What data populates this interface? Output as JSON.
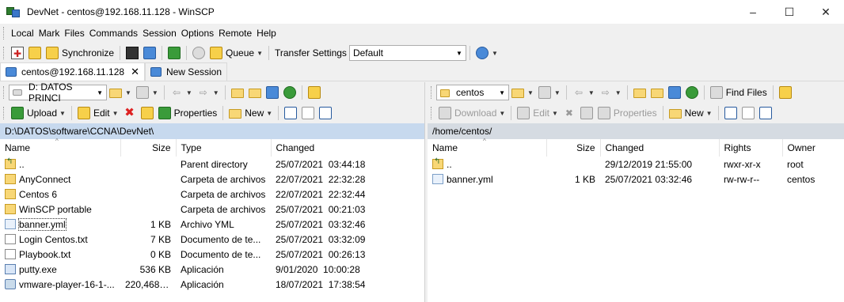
{
  "window": {
    "title": "DevNet - centos@192.168.11.128 - WinSCP",
    "controls": {
      "minimize": "–",
      "maximize": "☐",
      "close": "✕"
    }
  },
  "menu": [
    "Local",
    "Mark",
    "Files",
    "Commands",
    "Session",
    "Options",
    "Remote",
    "Help"
  ],
  "toolbar": {
    "synchronize": "Synchronize",
    "queue": "Queue",
    "transfer_settings_label": "Transfer Settings",
    "transfer_settings_value": "Default"
  },
  "tabs": [
    {
      "label": "centos@192.168.11.128",
      "close": "✕"
    },
    {
      "label": "New Session"
    }
  ],
  "left": {
    "drive": "D: DATOS PRINCI",
    "actions": {
      "upload": "Upload",
      "edit": "Edit",
      "properties": "Properties",
      "new": "New"
    },
    "path": "D:\\DATOS\\software\\CCNA\\DevNet\\",
    "columns": {
      "name": "Name",
      "size": "Size",
      "type": "Type",
      "changed": "Changed"
    },
    "rows": [
      {
        "icon": "parent",
        "name": "..",
        "size": "",
        "type": "Parent directory",
        "changed": "25/07/2021  03:44:18"
      },
      {
        "icon": "folder",
        "name": "AnyConnect",
        "size": "",
        "type": "Carpeta de archivos",
        "changed": "22/07/2021  22:32:28"
      },
      {
        "icon": "folder",
        "name": "Centos 6",
        "size": "",
        "type": "Carpeta de archivos",
        "changed": "22/07/2021  22:32:44"
      },
      {
        "icon": "folder",
        "name": "WinSCP portable",
        "size": "",
        "type": "Carpeta de archivos",
        "changed": "25/07/2021  00:21:03"
      },
      {
        "icon": "yml",
        "name": "banner.yml",
        "size": "1 KB",
        "type": "Archivo YML",
        "changed": "25/07/2021  03:32:46"
      },
      {
        "icon": "file",
        "name": "Login Centos.txt",
        "size": "7 KB",
        "type": "Documento de te...",
        "changed": "25/07/2021  03:32:09"
      },
      {
        "icon": "file",
        "name": "Playbook.txt",
        "size": "0 KB",
        "type": "Documento de te...",
        "changed": "25/07/2021  00:26:13"
      },
      {
        "icon": "exe",
        "name": "putty.exe",
        "size": "536 KB",
        "type": "Aplicación",
        "changed": "9/01/2020  10:00:28"
      },
      {
        "icon": "iso",
        "name": "vmware-player-16-1-...",
        "size": "220,468 KB",
        "type": "Aplicación",
        "changed": "18/07/2021  17:38:54"
      }
    ]
  },
  "right": {
    "folder": "centos",
    "find_files": "Find Files",
    "actions": {
      "download": "Download",
      "edit": "Edit",
      "properties": "Properties",
      "new": "New"
    },
    "path": "/home/centos/",
    "columns": {
      "name": "Name",
      "size": "Size",
      "changed": "Changed",
      "rights": "Rights",
      "owner": "Owner"
    },
    "rows": [
      {
        "icon": "parent",
        "name": "..",
        "size": "",
        "changed": "29/12/2019 21:55:00",
        "rights": "rwxr-xr-x",
        "owner": "root"
      },
      {
        "icon": "yml",
        "name": "banner.yml",
        "size": "1 KB",
        "changed": "25/07/2021 03:32:46",
        "rights": "rw-rw-r--",
        "owner": "centos"
      }
    ]
  }
}
